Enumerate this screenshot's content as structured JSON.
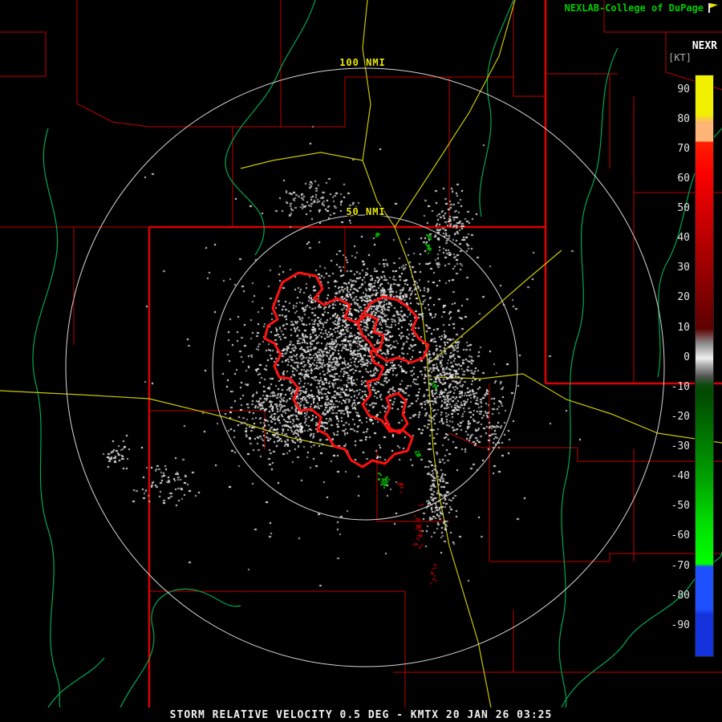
{
  "header": {
    "branding": "NEXLAB-College of DuPage"
  },
  "colorbar": {
    "title": "NEXR",
    "unit": "[KT]",
    "ticks": [
      "90",
      "80",
      "70",
      "60",
      "50",
      "40",
      "30",
      "20",
      "10",
      "0",
      "-10",
      "-20",
      "-30",
      "-40",
      "-50",
      "-60",
      "-70",
      "-80",
      "-90"
    ],
    "stops": [
      [
        95,
        "#f0f000"
      ],
      [
        82,
        "#f0f000"
      ],
      [
        79,
        "#ffb478"
      ],
      [
        73,
        "#ffb478"
      ],
      [
        72.5,
        "#ff1e00"
      ],
      [
        62,
        "#fa0000"
      ],
      [
        10,
        "#5f0000"
      ],
      [
        5,
        "#8c8c8c"
      ],
      [
        1,
        "#dcdcdc"
      ],
      [
        0,
        "#efefef"
      ],
      [
        -2,
        "#b4b4b4"
      ],
      [
        -6,
        "#555555"
      ],
      [
        -9,
        "#0a4b0a"
      ],
      [
        -12,
        "#004b00"
      ],
      [
        -40,
        "#00a000"
      ],
      [
        -55,
        "#00dc00"
      ],
      [
        -69,
        "#00ff00"
      ],
      [
        -70,
        "#1e50ff"
      ],
      [
        -84,
        "#1e50ff"
      ],
      [
        -86,
        "#1432dc"
      ],
      [
        -100,
        "#1432dc"
      ]
    ],
    "vmax": 95,
    "vmin": -100
  },
  "rings": {
    "outer": "100 NMI",
    "inner": "50 NMI"
  },
  "caption": "STORM RELATIVE VELOCITY 0.5 DEG - KMTX 20 JAN 26 03:25",
  "colors": {
    "branding": "#00cc00",
    "title": "#ffffff",
    "unit": "#b0b0b0",
    "tick": "#e4e4e4",
    "caption": "#f0f0f0",
    "county": "#c00000",
    "state": "#dc0000",
    "river": "#00a850",
    "road": "#c8c800",
    "ring": "#d8d8d8",
    "ring_label": "#e8e800",
    "warning": "#ff1010",
    "echo_grays": [
      "#9c9c9c",
      "#b4b4b4",
      "#c8c8c8",
      "#dcdcdc",
      "#efefef"
    ],
    "echo_green": "#00b400",
    "echo_red": "#a00000"
  }
}
